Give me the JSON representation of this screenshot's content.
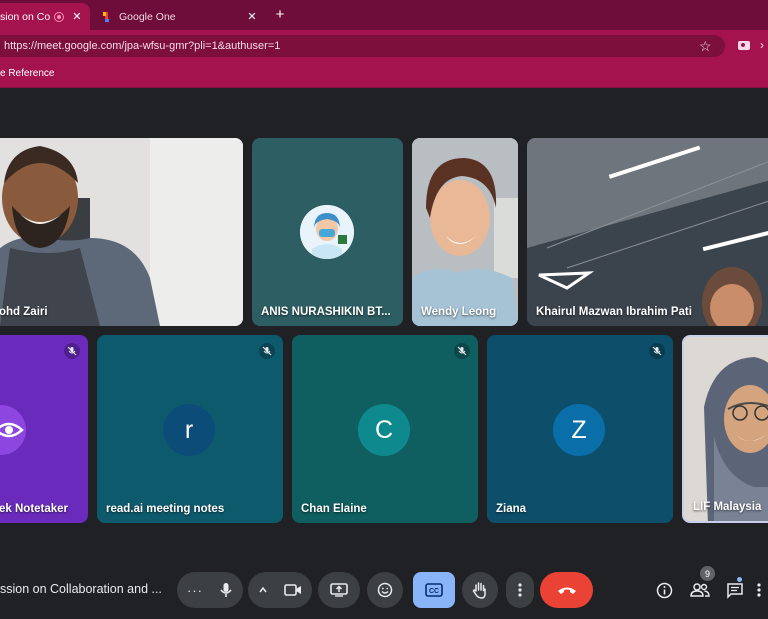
{
  "browser": {
    "tabs": [
      {
        "title": "sion on Collat",
        "active": true
      },
      {
        "title": "Google One",
        "active": false
      }
    ],
    "new_tab_glyph": "+",
    "url": "https://meet.google.com/jpa-wfsu-gmr?pli=1&authuser=1",
    "bookmark": "e Reference",
    "colors": {
      "tabbar": "#6e0d3a",
      "toolbar": "#a5134f"
    }
  },
  "meeting": {
    "title": "ssion on Collaboration and ...",
    "tiles_top": [
      {
        "name": "ohd Zairi",
        "kind": "video"
      },
      {
        "name": "ANIS NURASHIKIN BT...",
        "kind": "avatar"
      },
      {
        "name": "Wendy Leong",
        "kind": "video"
      },
      {
        "name": "Khairul Mazwan Ibrahim Pati",
        "kind": "video"
      }
    ],
    "tiles_bottom": [
      {
        "name": "ek Notetaker",
        "kind": "avatar",
        "muted": true
      },
      {
        "name": "read.ai meeting notes",
        "initial": "r",
        "muted": true
      },
      {
        "name": "Chan Elaine",
        "initial": "C",
        "muted": true
      },
      {
        "name": "Ziana",
        "initial": "Z",
        "muted": true
      },
      {
        "name": "LIF Malaysia",
        "kind": "video",
        "muted": false
      }
    ],
    "participant_count": "9"
  },
  "toolbar": {
    "icons": [
      "more-options-icon",
      "microphone-icon",
      "chevron-up-icon",
      "camera-icon",
      "present-screen-icon",
      "emoji-icon",
      "captions-icon",
      "raise-hand-icon",
      "more-vert-icon",
      "end-call-icon",
      "info-icon",
      "people-icon",
      "chat-icon",
      "activities-icon"
    ],
    "colors": {
      "end_call": "#ea4335",
      "captions_active": "#8ab4f8"
    }
  }
}
